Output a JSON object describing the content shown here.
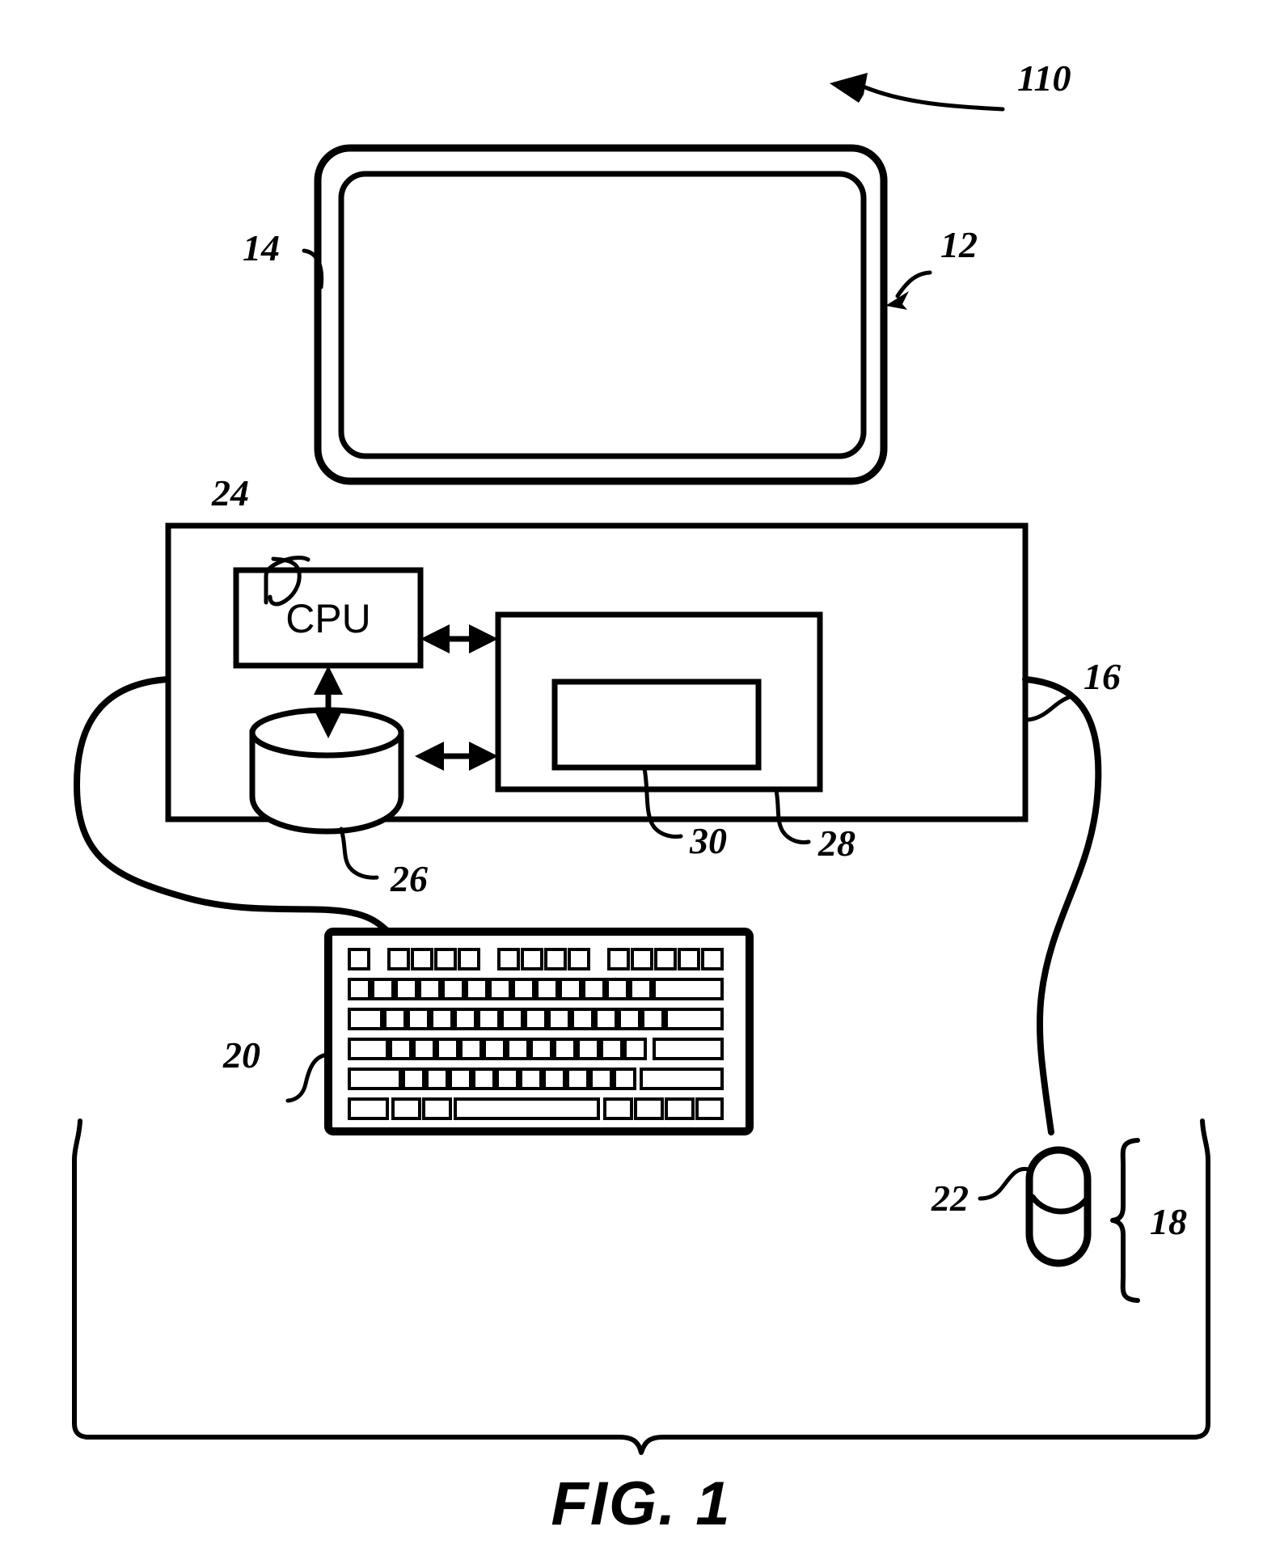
{
  "figure": {
    "caption": "FIG. 1",
    "title_number": "110",
    "description": "Patent line drawing of a computer system: display monitor, chassis with CPU, storage disk and memory blocks, keyboard and mouse"
  },
  "reference_numerals": {
    "system": {
      "number": "110",
      "target": "overall-computer-system"
    },
    "display_outer": {
      "number": "14",
      "target": "monitor-outer-bezel"
    },
    "display_inner": {
      "number": "12",
      "target": "monitor-screen"
    },
    "chassis": {
      "number": "16",
      "target": "computer-chassis"
    },
    "cpu": {
      "number": "24",
      "target": "cpu-block"
    },
    "disk": {
      "number": "26",
      "target": "storage-disk"
    },
    "memory_inner": {
      "number": "30",
      "target": "inner-memory-block"
    },
    "memory_outer": {
      "number": "28",
      "target": "outer-memory-block"
    },
    "keyboard": {
      "number": "20",
      "target": "keyboard"
    },
    "mouse": {
      "number": "22",
      "target": "mouse"
    },
    "input_devices": {
      "number": "18",
      "target": "user-input-devices-group"
    }
  },
  "blocks": {
    "cpu_label": "CPU"
  },
  "keyboard_rows": [
    {
      "row": 1,
      "key_widths": [
        46,
        0,
        46,
        46,
        46,
        46,
        0,
        46,
        46,
        46,
        46,
        0,
        46,
        46,
        46,
        46
      ],
      "gaps": [
        0,
        34,
        0,
        0,
        0,
        0,
        34,
        0,
        0,
        0,
        0,
        34,
        0,
        0,
        0,
        0
      ]
    },
    {
      "row": 2,
      "key_widths": [
        46,
        46,
        46,
        46,
        46,
        46,
        46,
        46,
        46,
        46,
        46,
        46,
        46,
        92
      ]
    },
    {
      "row": 3,
      "key_widths": [
        70,
        46,
        46,
        46,
        46,
        46,
        46,
        46,
        46,
        46,
        46,
        46,
        46,
        70
      ]
    },
    {
      "row": 4,
      "key_widths": [
        82,
        46,
        46,
        46,
        46,
        46,
        46,
        46,
        46,
        46,
        46,
        46,
        106
      ]
    },
    {
      "row": 5,
      "key_widths": [
        106,
        46,
        46,
        46,
        46,
        46,
        46,
        46,
        46,
        46,
        46,
        82
      ]
    },
    {
      "row": 6,
      "key_widths": [
        82,
        46,
        46,
        252,
        46,
        46,
        46,
        46
      ]
    }
  ],
  "colors": {
    "ink": "#000000",
    "paper": "#ffffff"
  }
}
